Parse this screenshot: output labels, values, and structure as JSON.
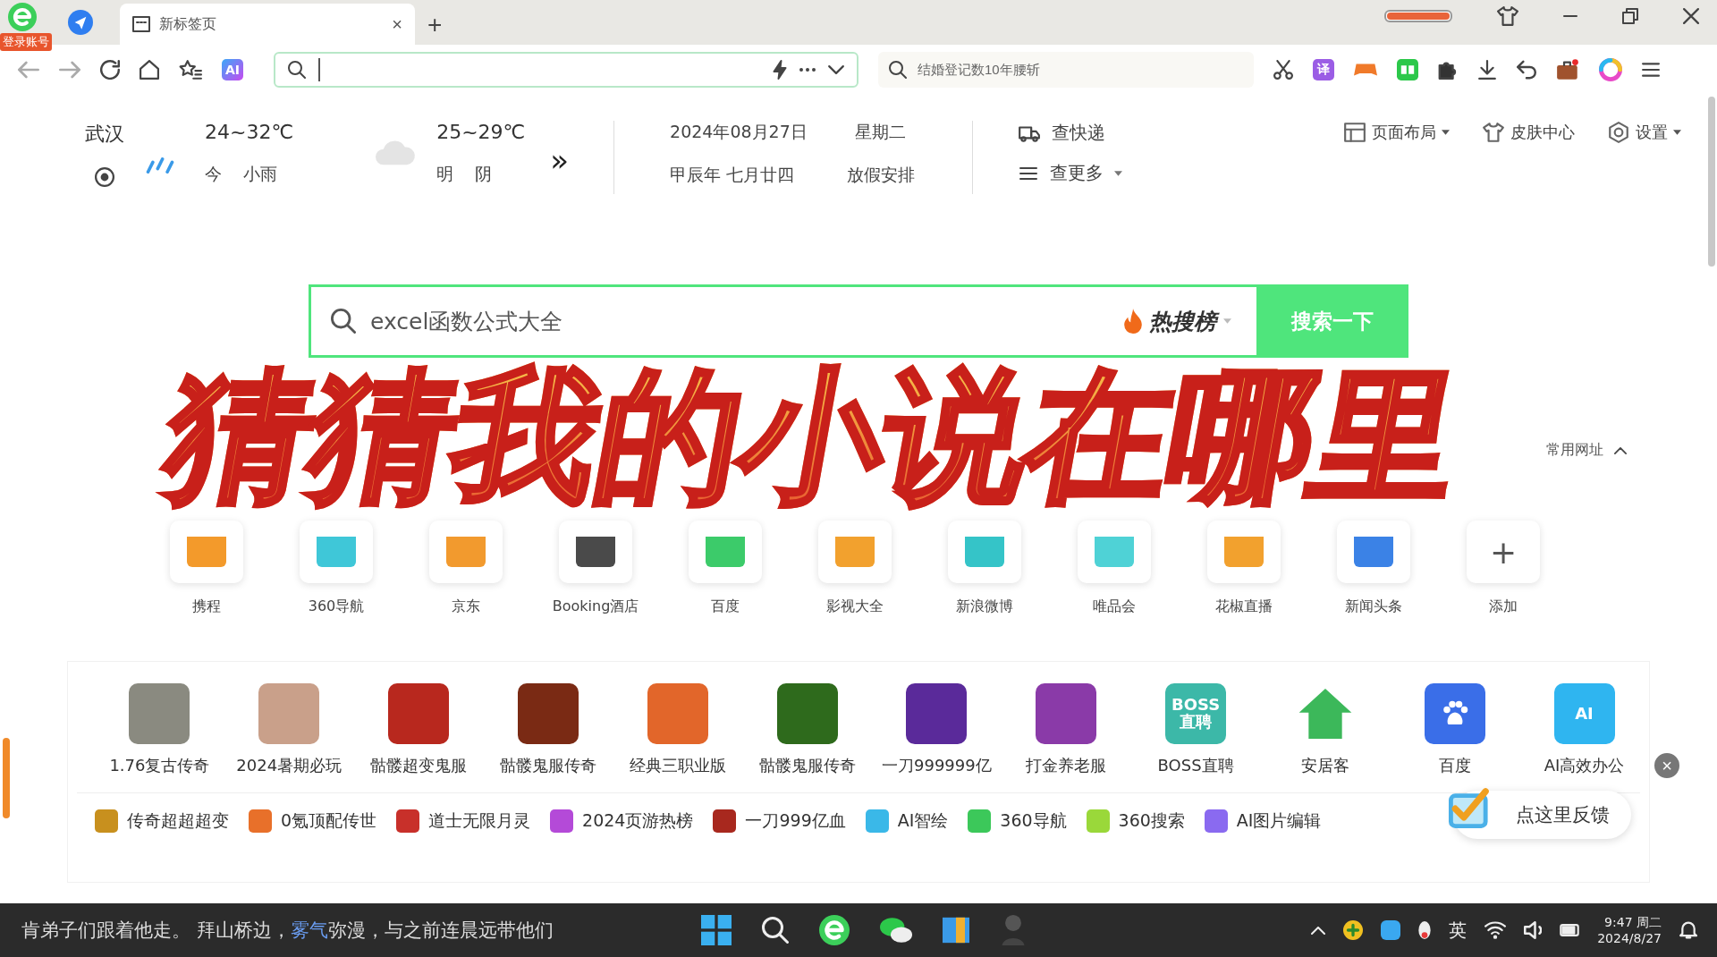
{
  "browser": {
    "login_badge": "登录账号",
    "tab": {
      "title": "新标签页",
      "close": "×"
    },
    "new_tab": "+",
    "side_search": {
      "placeholder": "结婚登记数10年腰斩"
    },
    "translate_glyph": "译",
    "ai_glyph": "AI"
  },
  "weather": {
    "city": "武汉",
    "today": {
      "range": "24~32℃",
      "day": "今",
      "condition": "小雨"
    },
    "tomorrow": {
      "range": "25~29℃",
      "day": "明",
      "condition": "阴"
    },
    "more": "»"
  },
  "calendar": {
    "date": "2024年08月27日",
    "weekday": "星期二",
    "lunar": "甲辰年 七月廿四",
    "holiday": "放假安排"
  },
  "tools": [
    {
      "kind": "express",
      "label": "查快递",
      "dropdown": false
    },
    {
      "kind": "more",
      "label": "查更多",
      "dropdown": true
    }
  ],
  "page_actions": [
    {
      "kind": "layout",
      "label": "页面布局",
      "dropdown": true
    },
    {
      "kind": "skin",
      "label": "皮肤中心",
      "dropdown": false
    },
    {
      "kind": "settings",
      "label": "设置",
      "dropdown": true
    }
  ],
  "search": {
    "value": "excel函数公式大全",
    "hot": "热搜榜",
    "button": "搜索一下"
  },
  "overlay_title": "猜猜我的小说在哪里",
  "frequent_sites_label": "常用网址",
  "sites": [
    {
      "label": "携程",
      "color": "#f39a2b"
    },
    {
      "label": "360导航",
      "color": "#3fc7d8"
    },
    {
      "label": "京东",
      "color": "#f29a2e"
    },
    {
      "label": "Booking酒店",
      "color": "#4a4a4a"
    },
    {
      "label": "百度",
      "color": "#3ccb6a"
    },
    {
      "label": "影视大全",
      "color": "#f2a12e"
    },
    {
      "label": "新浪微博",
      "color": "#35c4c8"
    },
    {
      "label": "唯品会",
      "color": "#4fd2d6"
    },
    {
      "label": "花椒直播",
      "color": "#f2a12e"
    },
    {
      "label": "新闻头条",
      "color": "#3b82e6"
    }
  ],
  "add": {
    "glyph": "+",
    "label": "添加"
  },
  "apps": [
    {
      "kind": "picture",
      "label": "1.76复古传奇",
      "color": "#8a8a80"
    },
    {
      "kind": "picture",
      "label": "2024暑期必玩",
      "color": "#c9a08a"
    },
    {
      "kind": "picture",
      "label": "骷髅超变鬼服",
      "color": "#b8281e"
    },
    {
      "kind": "picture",
      "label": "骷髅鬼服传奇",
      "color": "#7a2a14"
    },
    {
      "kind": "picture",
      "label": "经典三职业版",
      "color": "#e2662a"
    },
    {
      "kind": "picture",
      "label": "骷髅鬼服传奇",
      "color": "#2e6a1c"
    },
    {
      "kind": "picture",
      "label": "一刀999999亿",
      "color": "#5a2a9a"
    },
    {
      "kind": "picture",
      "label": "打金养老服",
      "color": "#8a3aa8"
    },
    {
      "kind": "text",
      "label": "BOSS直聘",
      "color": "#3cb8a8",
      "glyph": "BOSS 直聘"
    },
    {
      "kind": "house",
      "label": "安居客",
      "color": "#3cb85a"
    },
    {
      "kind": "paw",
      "label": "百度",
      "color": "#3a6ee8"
    },
    {
      "kind": "text",
      "label": "AI高效办公",
      "color": "#2fb5f0",
      "glyph": "AI"
    }
  ],
  "links": [
    {
      "label": "传奇超超超变",
      "color": "#c8901e"
    },
    {
      "label": "0氪顶配传世",
      "color": "#e8702a"
    },
    {
      "label": "道士无限月灵",
      "color": "#c8302a"
    },
    {
      "label": "2024页游热榜",
      "color": "#b44ad8"
    },
    {
      "label": "一刀999亿血",
      "color": "#a8281e"
    },
    {
      "label": "AI智绘",
      "color": "#3ab8e8"
    },
    {
      "label": "360导航",
      "color": "#3cc85a"
    },
    {
      "label": "360搜索",
      "color": "#9ad83a"
    },
    {
      "label": "AI图片编辑",
      "color": "#8a6af0"
    }
  ],
  "feedback": {
    "label": "点这里反馈",
    "close": "×"
  },
  "taskbar": {
    "ticker": [
      {
        "text": "肯弟子们跟着他走。 拜山桥边，",
        "highlight": false
      },
      {
        "text": "雾气",
        "highlight": true
      },
      {
        "text": "弥漫，与之前连晨远带他们",
        "highlight": false
      }
    ],
    "ime": "英",
    "time": "9:47 周二",
    "date": "2024/8/27"
  }
}
